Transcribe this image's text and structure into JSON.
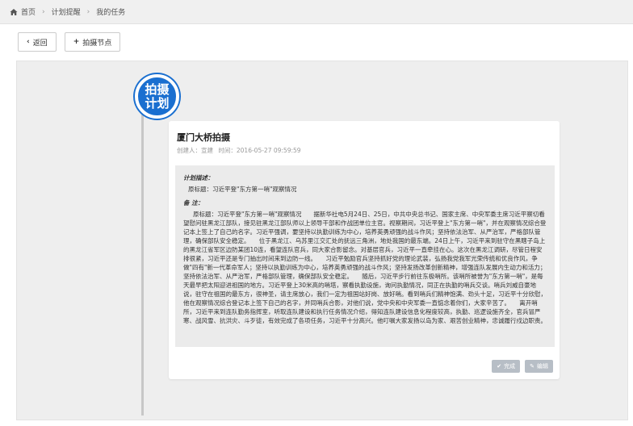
{
  "breadcrumb": {
    "items": [
      "首页",
      "计划提醒",
      "我的任务"
    ]
  },
  "toolbar": {
    "back_label": "返回",
    "add_node_label": "拍摄节点"
  },
  "timeline": {
    "node_line1": "拍摄",
    "node_line2": "计划",
    "accent_color": "#1a6fd0"
  },
  "card": {
    "title": "厦门大桥拍摄",
    "creator": "创建人：宣建",
    "time": "时间：2016-05-27 09:59:59",
    "plan_desc_label": "计划描述：",
    "plan_desc": "原标题：习近平登\"东方第一哨\"观察情况",
    "notes_label": "备 注：",
    "notes": "原标题：习近平登\"东方第一哨\"观察情况　　据新华社电5月24日、25日，中共中央总书记、国家主席、中央军委主席习近平察切看望慰问驻黑龙江部队，接见驻黑龙江部队师以上领导干部和作战团单位主官。视察期间，习近平登上\"东方第一哨\"，并在观察情况综合登记本上签上了自己的名字。习近平强调，要坚持以执勤训练为中心，培养英勇顽强的战斗作风；坚持依法治军、从严治军，严格部队管理，确保部队安全稳定。　　位于黑龙江、乌苏里江交汇处的抚远三角洲，地处我国的最东端。24日上午，习近平来到驻守在黑瞎子岛上的黑龙江省军区边防某团10连，看望连队官兵，同大家合影留念。对基层官兵，习近平一直牵挂在心。这次在黑龙江调研，尽管日程安排很紧，习近平还是专门抽出时间来到边防一线。　　习近平勉励官兵坚持抓好党的理论武装，弘扬我党我军光荣传统和优良作风，争做\"四有\"新一代革命军人；坚持以执勤训练为中心，培养英勇顽强的战斗作风；坚持发扬改革创新精神，增强连队发展内生动力和活力；坚持依法治军、从严治军，严格部队管理，确保部队安全稳定。　　随后，习近平步行前往东极哨所。该哨所被誉为\"东方第一哨\"，是每天最早把太阳迎进祖国的地方。习近平登上30米高的哨塔，察看执勤设施，询问执勤情况，同正在执勤的哨兵交谈。哨兵刘威自豪地说，驻守在祖国的最东方，很神圣，请主席放心，我们一定为祖国站好岗、放好哨。看到哨兵们精神饱满、劲头十足，习近平十分欣慰，他在观察情况综合登记本上签下自己的名字，并同哨兵合影，对他们说，党中央和中央军委一直惦念着你们，大家辛苦了。　　离开哨所，习近平来到连队勤务指挥室，听取连队建设和执行任务情况介绍，得知连队建设信息化程度较高，执勤、巡逻设施齐全，官兵冒严寒、战风雪、抗洪灾、斗歹徒，有效完成了各项任务，习近平十分高兴。他叮嘱大家发扬以岛为家、艰苦创业精神，忠诚履行戍边职责。",
    "done_label": "完成",
    "edit_label": "编辑"
  }
}
